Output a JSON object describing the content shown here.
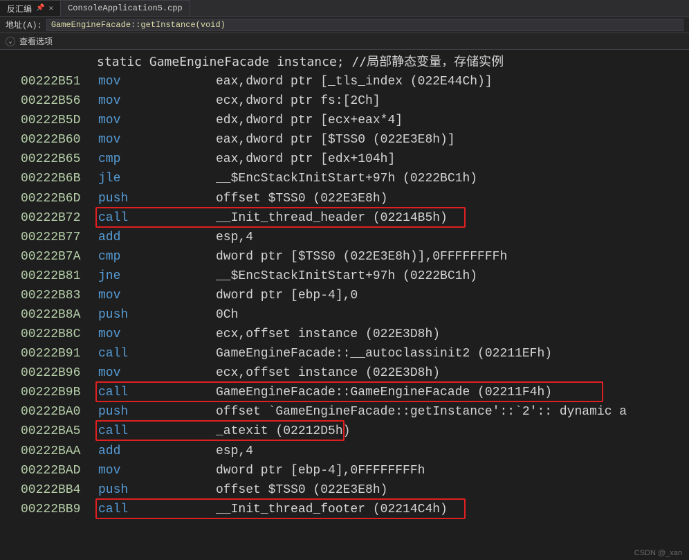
{
  "tabs": [
    {
      "label": "反汇编",
      "active": true,
      "pinned": true,
      "closable": true
    },
    {
      "label": "ConsoleApplication5.cpp",
      "active": false,
      "pinned": false,
      "closable": false
    }
  ],
  "address_bar": {
    "label": "地址(A):",
    "value": "GameEngineFacade::getInstance(void)"
  },
  "options_bar": {
    "label": "查看选项"
  },
  "comment_line": "static GameEngineFacade instance; //局部静态变量，存储实例",
  "lines": [
    {
      "addr": "00222B51",
      "mnem": "mov",
      "oper": "eax,dword ptr [_tls_index (022E44Ch)]"
    },
    {
      "addr": "00222B56",
      "mnem": "mov",
      "oper": "ecx,dword ptr fs:[2Ch]"
    },
    {
      "addr": "00222B5D",
      "mnem": "mov",
      "oper": "edx,dword ptr [ecx+eax*4]"
    },
    {
      "addr": "00222B60",
      "mnem": "mov",
      "oper": "eax,dword ptr [$TSS0 (022E3E8h)]"
    },
    {
      "addr": "00222B65",
      "mnem": "cmp",
      "oper": "eax,dword ptr [edx+104h]"
    },
    {
      "addr": "00222B6B",
      "mnem": "jle",
      "oper": "__$EncStackInitStart+97h (0222BC1h)"
    },
    {
      "addr": "00222B6D",
      "mnem": "push",
      "oper": "offset $TSS0 (022E3E8h)"
    },
    {
      "addr": "00222B72",
      "mnem": "call",
      "oper": "__Init_thread_header (02214B5h)",
      "hi_w": 535
    },
    {
      "addr": "00222B77",
      "mnem": "add",
      "oper": "esp,4"
    },
    {
      "addr": "00222B7A",
      "mnem": "cmp",
      "oper": "dword ptr [$TSS0 (022E3E8h)],0FFFFFFFFh"
    },
    {
      "addr": "00222B81",
      "mnem": "jne",
      "oper": "__$EncStackInitStart+97h (0222BC1h)"
    },
    {
      "addr": "00222B83",
      "mnem": "mov",
      "oper": "dword ptr [ebp-4],0"
    },
    {
      "addr": "00222B8A",
      "mnem": "push",
      "oper": "0Ch"
    },
    {
      "addr": "00222B8C",
      "mnem": "mov",
      "oper": "ecx,offset instance (022E3D8h)"
    },
    {
      "addr": "00222B91",
      "mnem": "call",
      "oper": "GameEngineFacade::__autoclassinit2 (02211EFh)"
    },
    {
      "addr": "00222B96",
      "mnem": "mov",
      "oper": "ecx,offset instance (022E3D8h)"
    },
    {
      "addr": "00222B9B",
      "mnem": "call",
      "oper": "GameEngineFacade::GameEngineFacade (02211F4h)",
      "hi_w": 734
    },
    {
      "addr": "00222BA0",
      "mnem": "push",
      "oper": "offset `GameEngineFacade::getInstance'::`2':: dynamic a"
    },
    {
      "addr": "00222BA5",
      "mnem": "call",
      "oper": "_atexit (02212D5h)",
      "hi_w": 360
    },
    {
      "addr": "00222BAA",
      "mnem": "add",
      "oper": "esp,4"
    },
    {
      "addr": "00222BAD",
      "mnem": "mov",
      "oper": "dword ptr [ebp-4],0FFFFFFFFh"
    },
    {
      "addr": "00222BB4",
      "mnem": "push",
      "oper": "offset $TSS0 (022E3E8h)"
    },
    {
      "addr": "00222BB9",
      "mnem": "call",
      "oper": "__Init_thread_footer (02214C4h)",
      "hi_w": 535
    }
  ],
  "watermark": "CSDN @_xan"
}
